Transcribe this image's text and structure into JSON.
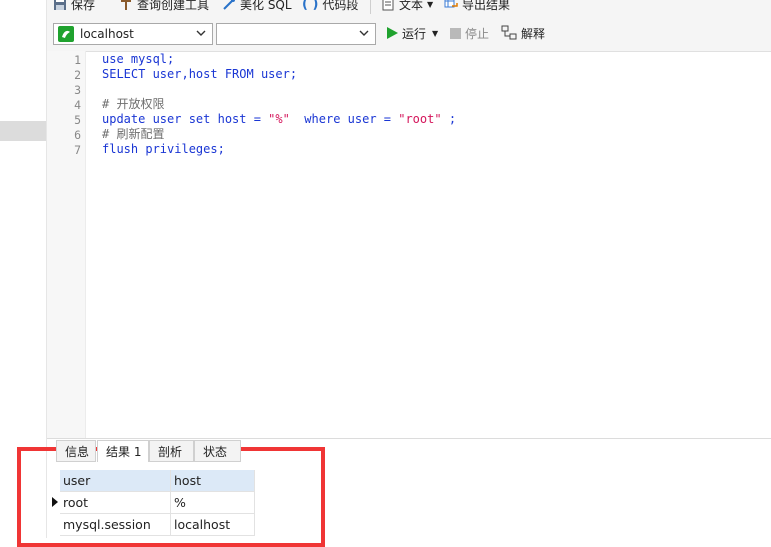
{
  "toolbar": {
    "save": "保存",
    "query_builder": "查询创建工具",
    "beautify": "美化 SQL",
    "snippet": "代码段",
    "text": "文本",
    "export": "导出结果"
  },
  "toolbar2": {
    "connection": "localhost",
    "database": "",
    "run": "运行",
    "stop": "停止",
    "explain": "解释"
  },
  "colors": {
    "keyword": "#1a36d4",
    "string": "#d4145a",
    "comment": "#6f6f6f",
    "highlight": "#f03535",
    "run": "#1fa22e"
  },
  "editor": {
    "line_numbers": [
      "1",
      "2",
      "3",
      "4",
      "5",
      "6",
      "7"
    ],
    "lines": [
      [
        {
          "t": "use mysql;",
          "c": "kw"
        }
      ],
      [
        {
          "t": "SELECT user,host FROM user;",
          "c": "kw"
        }
      ],
      [],
      [
        {
          "t": "# 开放权限",
          "c": "cm"
        }
      ],
      [
        {
          "t": "update user set host = ",
          "c": "kw"
        },
        {
          "t": "\"%\"",
          "c": "str"
        },
        {
          "t": "  where user = ",
          "c": "kw"
        },
        {
          "t": "\"root\"",
          "c": "str"
        },
        {
          "t": " ;",
          "c": "kw"
        }
      ],
      [
        {
          "t": "# 刷新配置",
          "c": "cm"
        }
      ],
      [
        {
          "t": "flush privileges;",
          "c": "kw"
        }
      ]
    ]
  },
  "results": {
    "tabs": [
      "信息",
      "结果 1",
      "剖析",
      "状态"
    ],
    "columns": [
      "user",
      "host"
    ],
    "rows": [
      [
        "root",
        "%"
      ],
      [
        "mysql.session",
        "localhost"
      ]
    ]
  }
}
